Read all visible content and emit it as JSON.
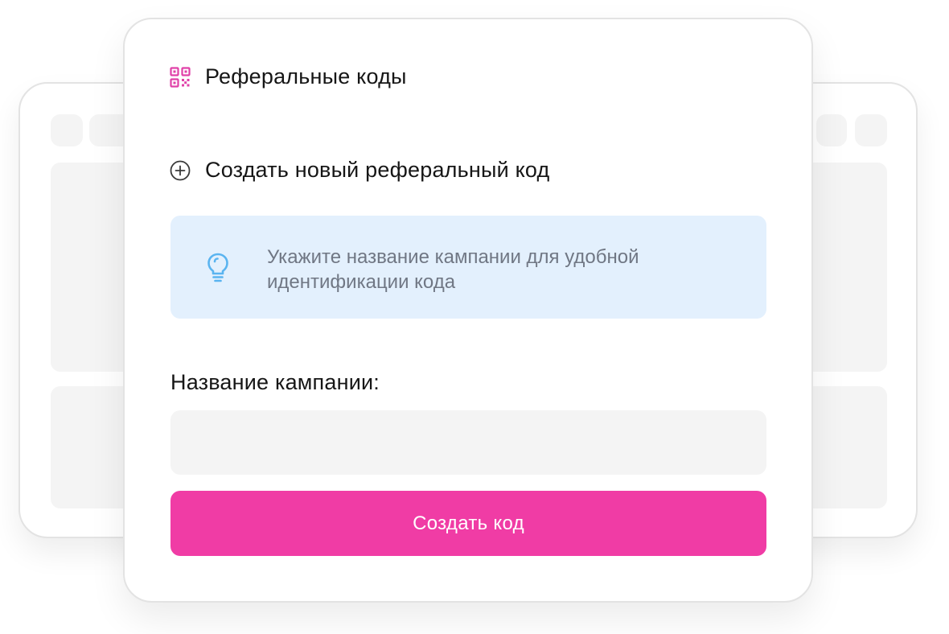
{
  "panel": {
    "title": "Реферальные коды",
    "title_icon": "qr-code-icon"
  },
  "create": {
    "label": "Создать новый реферальный код",
    "icon": "plus-circle-icon"
  },
  "hint": {
    "icon": "lightbulb-icon",
    "text": "Укажите название кампании для удобной идентификации кода"
  },
  "form": {
    "campaign_label": "Название кампании:",
    "campaign_value": "",
    "campaign_placeholder": ""
  },
  "submit": {
    "label": "Создать код"
  },
  "colors": {
    "accent": "#f03ca5",
    "hint_bg": "#e3f0fd",
    "hint_icon": "#5ab4f0",
    "field_bg": "#f4f4f4",
    "qr_icon": "#e040a8"
  }
}
